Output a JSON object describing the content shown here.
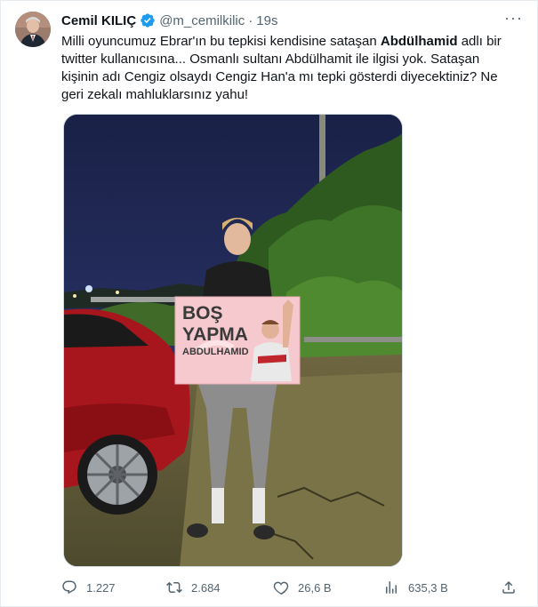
{
  "author": {
    "name": "Cemil KILIÇ",
    "handle": "@m_cemilkilic",
    "separator": "·",
    "time": "19s"
  },
  "text": {
    "part1": "Milli oyuncumuz Ebrar'ın bu tepkisi kendisine sataşan ",
    "bold": "Abdülhamid",
    "part2": " adlı bir twitter kullanıcısına... Osmanlı sultanı Abdülhamit ile ilgisi yok. Sataşan kişinin adı Cengiz olsaydı Cengiz Han'a mı tepki gösterdi diyecektiniz? Ne geri zekalı mahluklarsınız yahu!"
  },
  "media": {
    "sign_line1": "BOŞ",
    "sign_line2": "YAPMA",
    "sign_line3": "ABDULHAMID"
  },
  "actions": {
    "replies": "1.227",
    "retweets": "2.684",
    "likes": "26,6 B",
    "views": "635,3 B"
  },
  "colors": {
    "verified": "#1d9bf0",
    "muted": "#536471",
    "sign": "#f6c9cf"
  }
}
